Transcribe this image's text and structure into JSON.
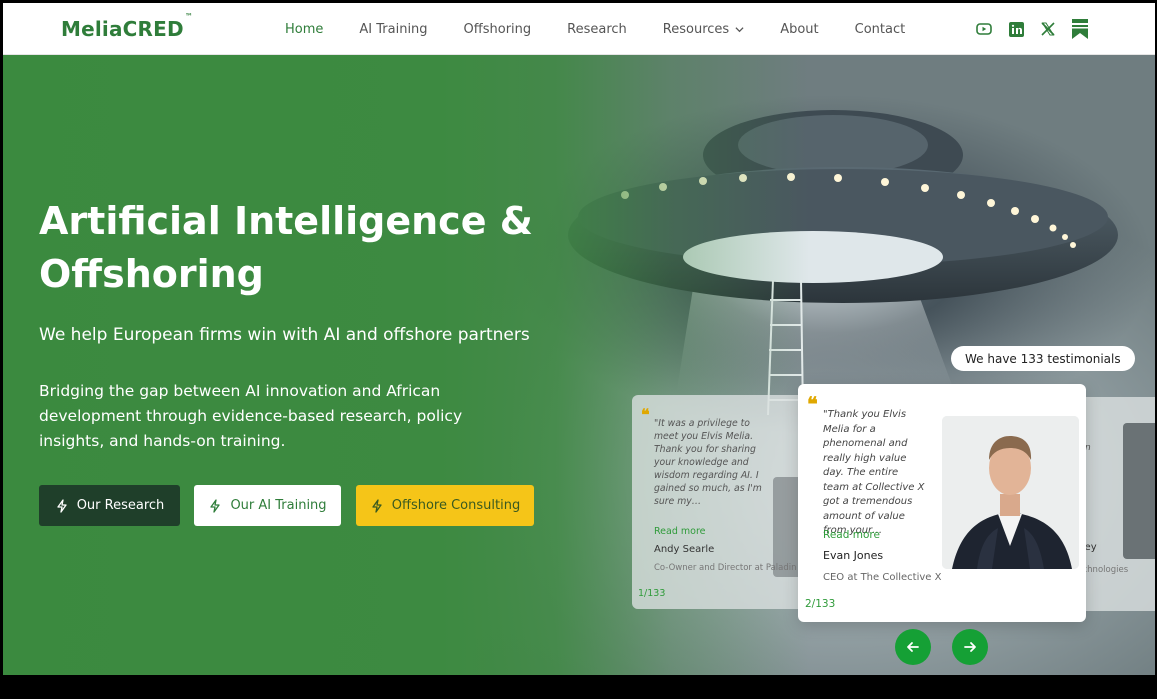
{
  "brand": {
    "name": "MeliaCRED",
    "tm": "™"
  },
  "nav": {
    "items": [
      {
        "label": "Home"
      },
      {
        "label": "AI Training"
      },
      {
        "label": "Offshoring"
      },
      {
        "label": "Research"
      },
      {
        "label": "Resources"
      },
      {
        "label": "About"
      },
      {
        "label": "Contact"
      }
    ],
    "socials": [
      "youtube-icon",
      "linkedin-icon",
      "x-icon",
      "bookmark-icon"
    ]
  },
  "hero": {
    "title": "Artificial Intelligence & Offshoring",
    "subtitle": "We help European firms win with AI and offshore partners",
    "description": "Bridging the gap between AI innovation and African development through evidence-based research, policy insights, and hands-on training.",
    "buttons": {
      "research": "Our Research",
      "ai_training": "Our AI Training",
      "offshore": "Offshore Consulting"
    }
  },
  "testimonials": {
    "badge": "We have 133 testimonials",
    "left": {
      "quote": "\"It was a privilege to meet you Elvis Melia. Thank you for sharing your knowledge and wisdom regarding AI. I gained so much, as I'm sure my…",
      "read_more": "Read more",
      "name": "Andy Searle",
      "role": "Co-Owner and Director at Paladin",
      "count": "1/133"
    },
    "main": {
      "quote": "\"Thank you Elvis Melia for a phenomenal and really high value day. The entire team at Collective X got a tremendous amount of value from your…",
      "read_more": "Read more",
      "name": "Evan Jones",
      "role": "CEO at The Collective X",
      "count": "2/133"
    },
    "right": {
      "text1": "n",
      "text2": "ery",
      "name": "lley",
      "role": "A Technologies"
    }
  },
  "colors": {
    "brand_green": "#2f7d3a",
    "accent_yellow": "#f5c518",
    "arrow_green": "#15a035"
  }
}
